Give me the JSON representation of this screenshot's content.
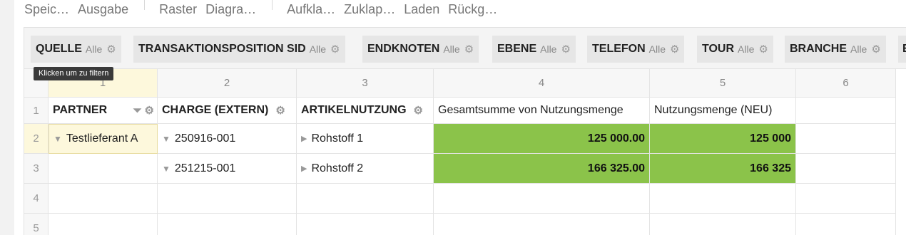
{
  "toolbar": {
    "group1": [
      "Speic…",
      "Ausgabe"
    ],
    "group2": [
      "Raster",
      "Diagra…"
    ],
    "group3": [
      "Aufkla…",
      "Zuklap…",
      "Laden",
      "Rückg…"
    ]
  },
  "filters": [
    {
      "label": "QUELLE",
      "all": "Alle"
    },
    {
      "label": "TRANSAKTIONSPOSITION SID",
      "all": "Alle"
    },
    {
      "label": "ENDKNOTEN",
      "all": "Alle"
    },
    {
      "label": "EBENE",
      "all": "Alle"
    },
    {
      "label": "TELEFON",
      "all": "Alle"
    },
    {
      "label": "TOUR",
      "all": "Alle"
    },
    {
      "label": "BRANCHE",
      "all": "Alle"
    }
  ],
  "tooltip": "Klicken um zu filtern",
  "grid": {
    "column_numbers": [
      "1",
      "2",
      "3",
      "4",
      "5",
      "6"
    ],
    "row_numbers": [
      "1",
      "2",
      "3",
      "4",
      "5"
    ],
    "headers": {
      "partner": "PARTNER",
      "charge": "CHARGE (EXTERN)",
      "artikel": "ARTIKELNUTZUNG",
      "sum": "Gesamtsumme von Nutzungsmenge",
      "neu": "Nutzungsmenge (NEU)"
    },
    "rows": [
      {
        "partner": "Testlieferant A",
        "charge": "250916-001",
        "artikel": "Rohstoff 1",
        "sum": "125 000.00",
        "neu": "125 000"
      },
      {
        "partner": "",
        "charge": "251215-001",
        "artikel": "Rohstoff 2",
        "sum": "166 325.00",
        "neu": "166 325"
      }
    ]
  },
  "colors": {
    "value_fill": "#8bc34a",
    "selection": "#fdf8dc"
  }
}
